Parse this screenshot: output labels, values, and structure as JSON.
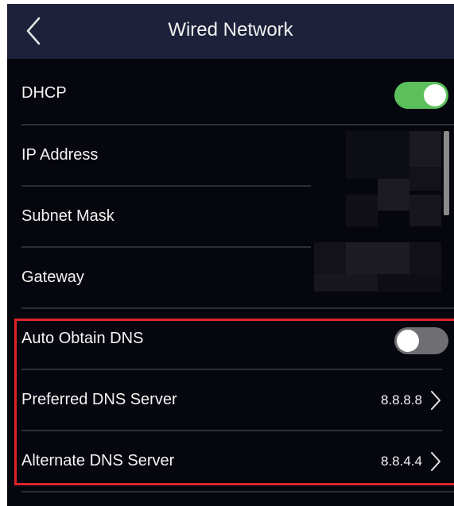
{
  "header": {
    "title": "Wired Network"
  },
  "rows": {
    "dhcp": {
      "label": "DHCP",
      "state": "on"
    },
    "ip": {
      "label": "IP Address"
    },
    "subnet": {
      "label": "Subnet Mask"
    },
    "gateway": {
      "label": "Gateway"
    },
    "auto_dns": {
      "label": "Auto Obtain DNS",
      "state": "off"
    },
    "preferred_dns": {
      "label": "Preferred DNS Server",
      "value": "8.8.8.8"
    },
    "alternate_dns": {
      "label": "Alternate DNS Server",
      "value": "8.8.4.4"
    }
  },
  "colors": {
    "header_bg": "#1d2139",
    "screen_bg": "#06060e",
    "toggle_on": "#5bc05b",
    "toggle_off": "#6f6f73",
    "highlight": "#e0232b"
  },
  "icons": {
    "back": "chevron-left-icon",
    "forward": "chevron-right-icon"
  }
}
